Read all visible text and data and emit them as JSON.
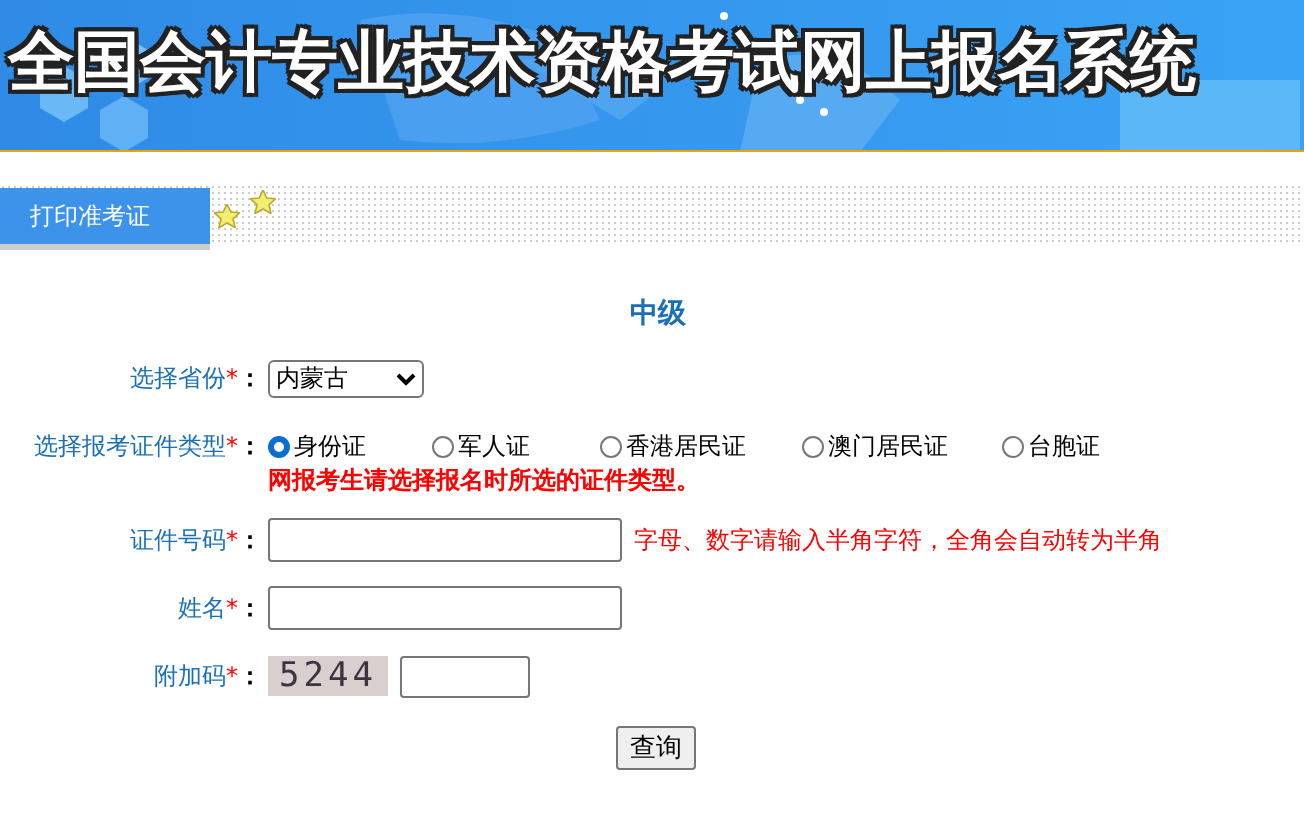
{
  "header": {
    "title": "全国会计专业技术资格考试网上报名系统"
  },
  "nav": {
    "tab": {
      "label": "打印准考证",
      "selected": true
    }
  },
  "form": {
    "level": "中级",
    "province": {
      "label": "选择省份",
      "required": "*",
      "colon": "：",
      "value": "内蒙古"
    },
    "certificate": {
      "label": "选择报考证件类型",
      "required": "*",
      "colon": "：",
      "options": [
        {
          "label": "身份证",
          "selected": true
        },
        {
          "label": "军人证",
          "selected": false
        },
        {
          "label": "香港居民证",
          "selected": false
        },
        {
          "label": "澳门居民证",
          "selected": false
        },
        {
          "label": "台胞证",
          "selected": false
        }
      ],
      "notice": "网报考生请选择报名时所选的证件类型。"
    },
    "id_number": {
      "label": "证件号码",
      "required": "*",
      "colon": "：",
      "hint": "字母、数字请输入半角字符，全角会自动转为半角"
    },
    "name": {
      "label": "姓名",
      "required": "*",
      "colon": "："
    },
    "captcha": {
      "label": "附加码",
      "required": "*",
      "colon": "：",
      "code": "5244"
    },
    "submit": "查询"
  }
}
